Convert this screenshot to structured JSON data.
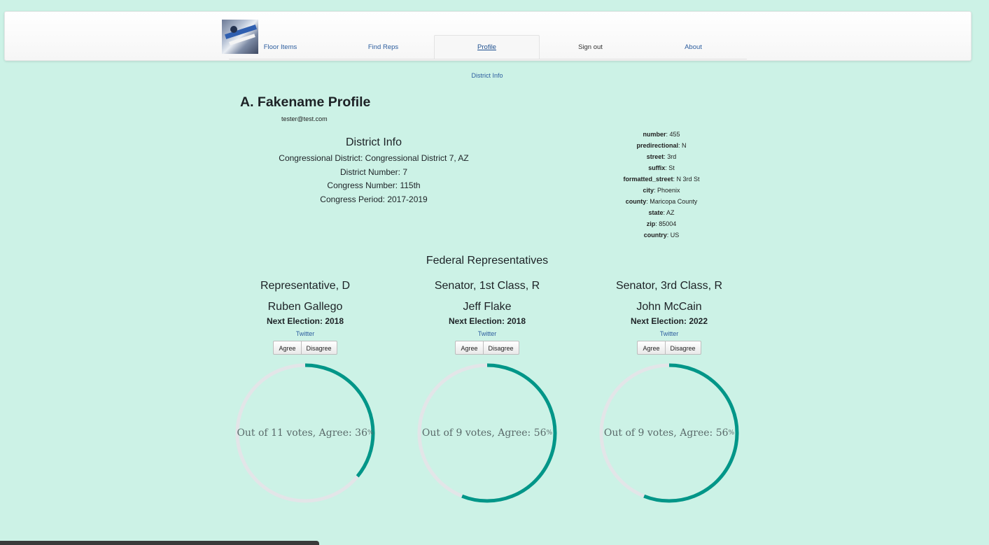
{
  "nav": {
    "tabs": [
      {
        "label": "Floor Items"
      },
      {
        "label": "Find Reps"
      },
      {
        "label": "Profile"
      },
      {
        "label": "Sign out"
      },
      {
        "label": "About"
      }
    ],
    "subtab": "District Info"
  },
  "profile": {
    "title": "A. Fakename Profile",
    "email": "tester@test.com"
  },
  "district": {
    "heading": "District Info",
    "congressional_district": "Congressional District: Congressional District 7, AZ",
    "district_number": "District Number: 7",
    "congress_number": "Congress Number: 115th",
    "congress_period": "Congress Period: 2017-2019"
  },
  "address": {
    "number": {
      "key": "number",
      "value": ": 455"
    },
    "predirectional": {
      "key": "predirectional",
      "value": ": N"
    },
    "street": {
      "key": "street",
      "value": ": 3rd"
    },
    "suffix": {
      "key": "suffix",
      "value": ": St"
    },
    "formatted_street": {
      "key": "formatted_street",
      "value": ": N 3rd St"
    },
    "city": {
      "key": "city",
      "value": ": Phoenix"
    },
    "county": {
      "key": "county",
      "value": ": Maricopa County"
    },
    "state": {
      "key": "state",
      "value": ": AZ"
    },
    "zip": {
      "key": "zip",
      "value": ": 85004"
    },
    "country": {
      "key": "country",
      "value": ": US"
    }
  },
  "federal": {
    "heading": "Federal Representatives",
    "reps": [
      {
        "role": "Representative, D",
        "name": "Ruben Gallego",
        "next_election": "Next Election: 2018",
        "twitter": "Twitter",
        "agree": "Agree",
        "disagree": "Disagree",
        "votes_text": "Out of 11 votes, Agree: 36",
        "pct_sign": "%",
        "agree_fraction": 0.36
      },
      {
        "role": "Senator, 1st Class, R",
        "name": "Jeff Flake",
        "next_election": "Next Election: 2018",
        "twitter": "Twitter",
        "agree": "Agree",
        "disagree": "Disagree",
        "votes_text": "Out of 9 votes, Agree: 56",
        "pct_sign": "%",
        "agree_fraction": 0.56
      },
      {
        "role": "Senator, 3rd Class, R",
        "name": "John McCain",
        "next_election": "Next Election: 2022",
        "twitter": "Twitter",
        "agree": "Agree",
        "disagree": "Disagree",
        "votes_text": "Out of 9 votes, Agree: 56",
        "pct_sign": "%",
        "agree_fraction": 0.56
      }
    ]
  },
  "colors": {
    "background": "#ccf2e6",
    "ring_fill": "#009688",
    "ring_track": "#e3e5e8",
    "link": "#2c5d9e"
  }
}
